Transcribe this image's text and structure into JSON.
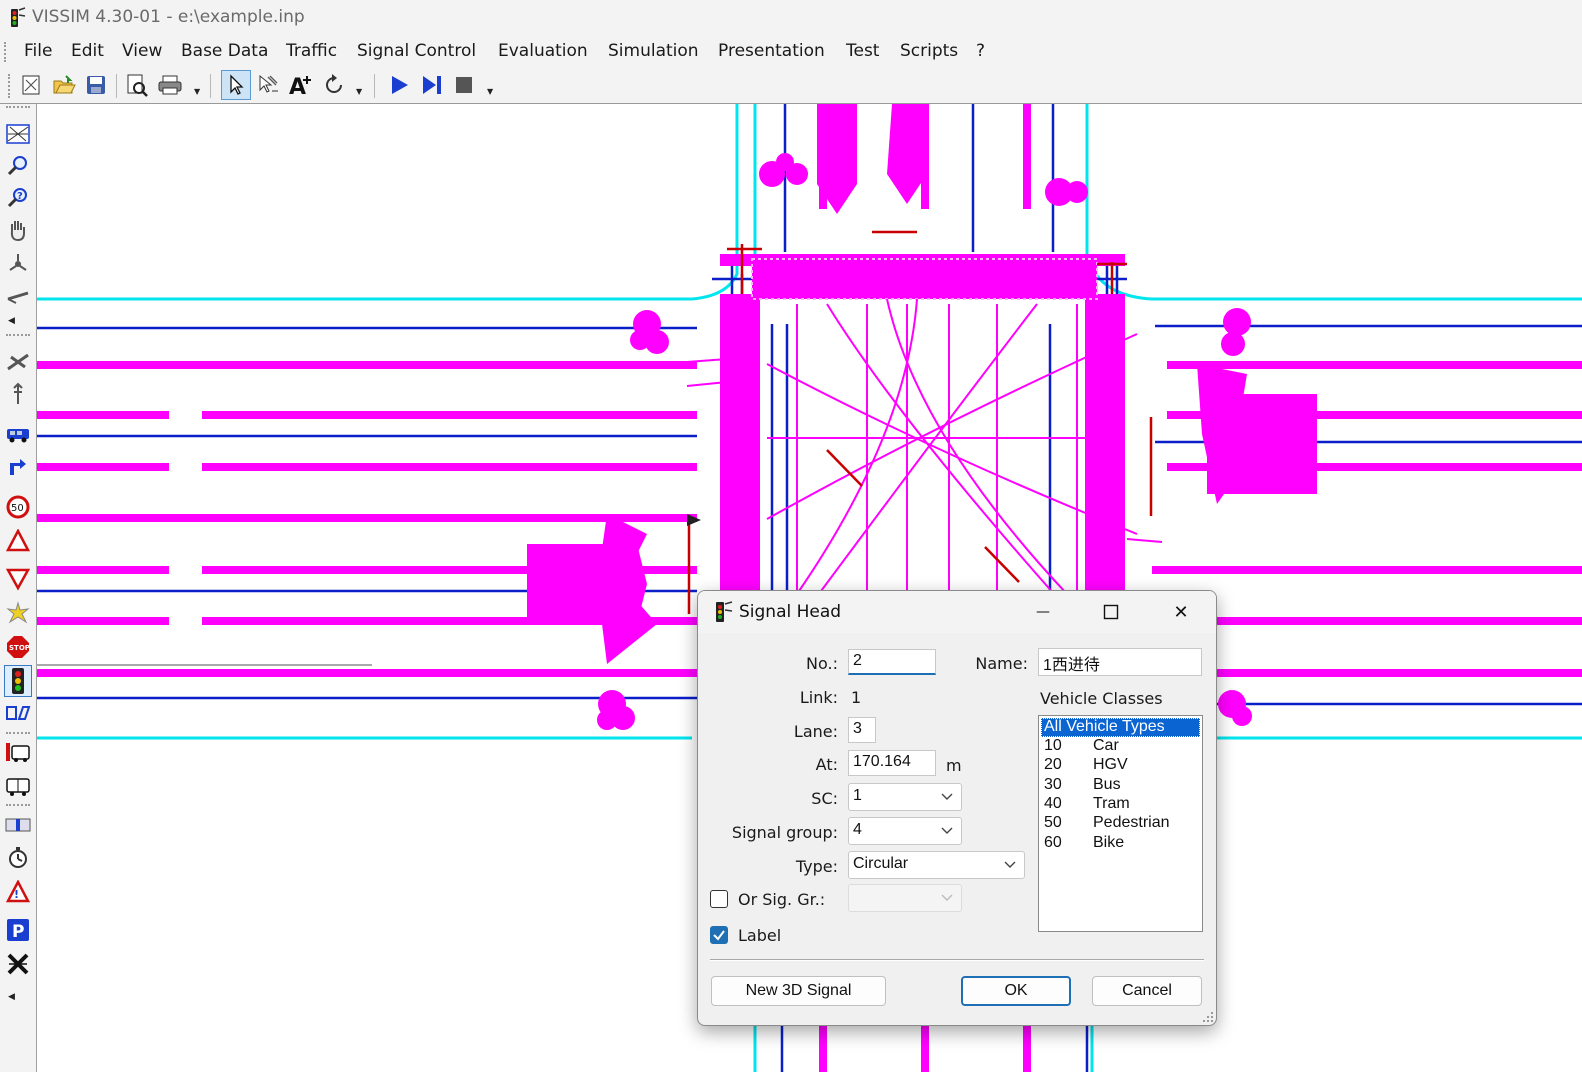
{
  "window": {
    "title": "VISSIM 4.30-01 - e:\\example.inp"
  },
  "menu": [
    {
      "label": "File"
    },
    {
      "label": "Edit"
    },
    {
      "label": "View"
    },
    {
      "label": "Base Data"
    },
    {
      "label": "Traffic"
    },
    {
      "label": "Signal Control"
    },
    {
      "label": "Evaluation"
    },
    {
      "label": "Simulation"
    },
    {
      "label": "Presentation"
    },
    {
      "label": "Test"
    },
    {
      "label": "Scripts"
    },
    {
      "label": "?"
    }
  ],
  "toolbar_icons": [
    "new-network-icon",
    "open-folder-icon",
    "save-icon",
    "print-preview-icon",
    "print-icon",
    "select-pointer-icon",
    "multi-select-icon",
    "add-label-icon",
    "rotate-icon",
    "run-continuous-icon",
    "single-step-icon",
    "stop-icon"
  ],
  "left_toolbar_icons": [
    "network-overview-icon",
    "zoom-in-icon",
    "zoom-out-icon",
    "pan-hand-icon",
    "rotate-network-icon",
    "links-connectors-icon",
    "background-icon",
    "nodes-icon",
    "vehicle-inputs-icon",
    "routing-decisions-icon",
    "speed-decision-icon",
    "reduced-speed-icon",
    "priority-rules-icon",
    "conflict-areas-icon",
    "stop-sign-icon",
    "signal-head-icon",
    "detectors-icon",
    "transit-stops-icon",
    "transit-lines-icon",
    "measurement-icon",
    "travel-times-icon",
    "queue-counters-icon",
    "parking-icon",
    "data-collection-icon"
  ],
  "dialog": {
    "title": "Signal Head",
    "no_label": "No.:",
    "no_value": "2",
    "name_label": "Name:",
    "name_value": "1西进待",
    "link_label": "Link:",
    "link_value": "1",
    "lane_label": "Lane:",
    "lane_value": "3",
    "at_label": "At:",
    "at_value": "170.164",
    "at_unit": "m",
    "sc_label": "SC:",
    "sc_value": "1",
    "signal_group_label": "Signal group:",
    "signal_group_value": "4",
    "type_label": "Type:",
    "type_value": "Circular",
    "or_sig_label": "Or Sig. Gr.:",
    "or_sig_checked": false,
    "label_label": "Label",
    "label_checked": true,
    "vehicle_classes_label": "Vehicle Classes",
    "vehicle_classes": [
      {
        "id": "All Vehicle Types",
        "name": "",
        "selected": true
      },
      {
        "id": "10",
        "name": "Car",
        "selected": false
      },
      {
        "id": "20",
        "name": "HGV",
        "selected": false
      },
      {
        "id": "30",
        "name": "Bus",
        "selected": false
      },
      {
        "id": "40",
        "name": "Tram",
        "selected": false
      },
      {
        "id": "50",
        "name": "Pedestrian",
        "selected": false
      },
      {
        "id": "60",
        "name": "Bike",
        "selected": false
      }
    ],
    "new3d_label": "New 3D Signal",
    "ok_label": "OK",
    "cancel_label": "Cancel",
    "minimize_glyph": "—",
    "close_glyph": "✕"
  },
  "colors": {
    "road_edge": "#00e5ee",
    "lane_center": "#0a1fc8",
    "link_magenta": "#ff00ff",
    "signal_red": "#c80000",
    "accent": "#1f6fb5"
  }
}
